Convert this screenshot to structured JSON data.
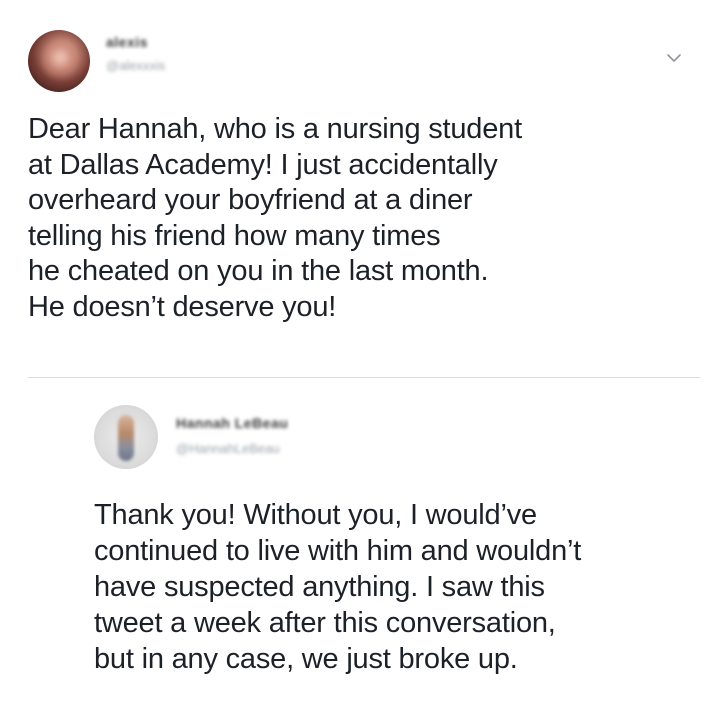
{
  "tweet": {
    "author_name": "alexis",
    "author_handle": "@alexxxis",
    "menu_icon": "chevron-down-icon",
    "text_lines": [
      "Dear Hannah, who is a nursing student",
      "at Dallas Academy! I just accidentally",
      "overheard your boyfriend at a diner",
      "telling his friend how many times",
      "he cheated on you in the last month.",
      "He doesn’t deserve you!"
    ]
  },
  "reply": {
    "author_name": "Hannah LeBeau",
    "author_handle": "@HannahLeBeau",
    "text_lines": [
      "Thank you! Without you, I would’ve",
      "continued to live with him and wouldn’t",
      "have suspected anything. I saw this",
      "tweet a week after this conversation,",
      "but in any case, we just broke up."
    ]
  },
  "colors": {
    "text": "#1c2127",
    "handle": "#9aa3ab",
    "divider": "#d9dde0",
    "chevron": "#8f979e"
  }
}
